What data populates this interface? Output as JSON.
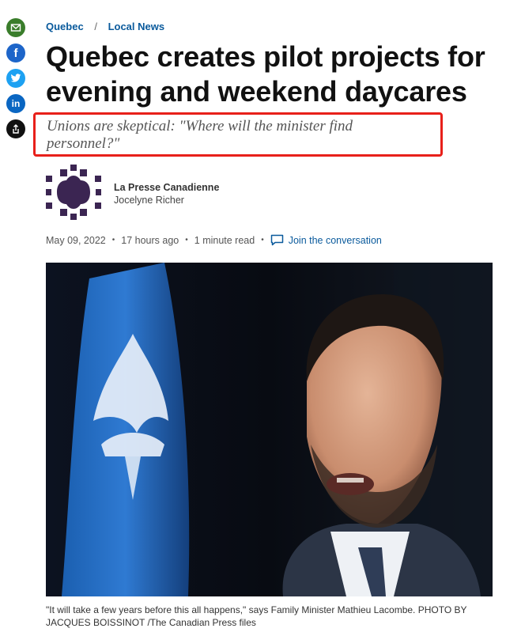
{
  "share": {
    "items": [
      {
        "name": "email",
        "color": "#3a7d2b"
      },
      {
        "name": "facebook",
        "color": "#1d65c9"
      },
      {
        "name": "twitter",
        "color": "#1da1f2"
      },
      {
        "name": "linkedin",
        "color": "#0a66c2"
      },
      {
        "name": "share",
        "color": "#111111"
      }
    ],
    "facebook_glyph": "f",
    "linkedin_glyph": "in"
  },
  "breadcrumb": {
    "section": "Quebec",
    "separator": "/",
    "subsection": "Local News"
  },
  "article": {
    "headline": "Quebec creates pilot projects for evening and weekend daycares",
    "deck": "Unions are skeptical: \"Where will the minister find personnel?\"",
    "source": "La Presse Canadienne",
    "author": "Jocelyne Richer",
    "date": "May 09, 2022",
    "age": "17 hours ago",
    "read_time": "1 minute read",
    "join_label": "Join the conversation",
    "dot": "•",
    "caption": "\"It will take a few years before this all happens,\" says Family Minister Mathieu Lacombe. PHOTO BY JACQUES BOISSINOT /The Canadian Press files"
  },
  "colors": {
    "link": "#0a5a9c",
    "highlight_border": "#e8201a",
    "logo": "#3b2552"
  }
}
